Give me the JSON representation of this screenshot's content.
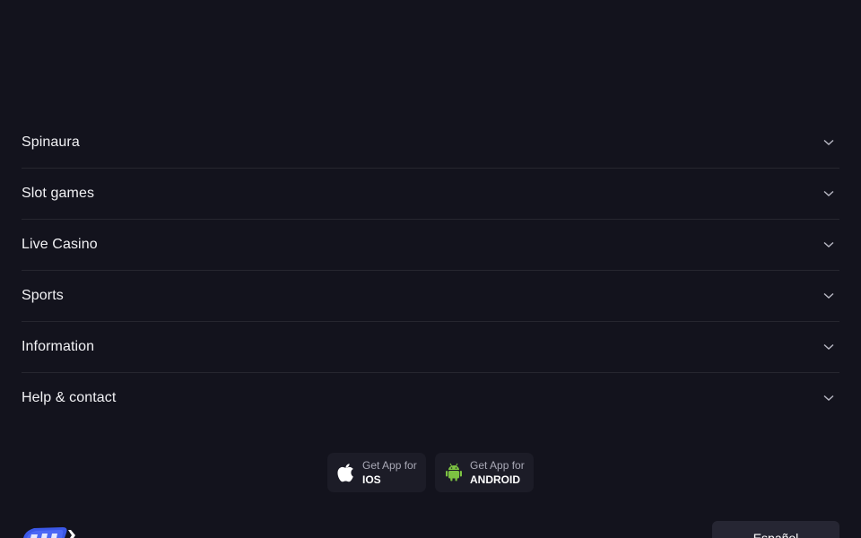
{
  "accordion": {
    "items": [
      {
        "label": "Spinaura"
      },
      {
        "label": "Slot games"
      },
      {
        "label": "Live Casino"
      },
      {
        "label": "Sports"
      },
      {
        "label": "Information"
      },
      {
        "label": "Help & contact"
      }
    ]
  },
  "apps": {
    "ios": {
      "small": "Get App for",
      "big": "IOS",
      "icon": "apple-icon"
    },
    "android": {
      "small": "Get App for",
      "big": "ANDROID",
      "icon": "android-icon"
    }
  },
  "footer": {
    "logo_icon": "spin-logo",
    "language_selected": "Español"
  },
  "colors": {
    "background": "#13131d",
    "divider": "#26262f",
    "android_green": "#7cc242",
    "logo_blue": "#3b58e8"
  }
}
